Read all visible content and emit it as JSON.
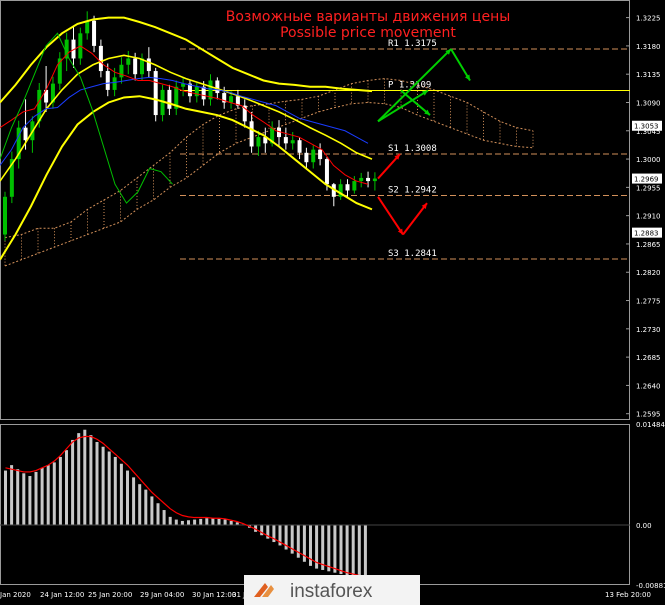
{
  "title": {
    "ru": "Возможные варианты движения цены",
    "en": "Possible price movement"
  },
  "colors": {
    "background": "#000000",
    "frame": "#9a9a9a",
    "grid": "#2a2a2a",
    "bull_candle": "#00c000",
    "bear_candle": "#ffffff",
    "bollinger": "#ffff00",
    "tenkan": "#ff0000",
    "kijun": "#1a3cff",
    "chikou": "#00c000",
    "cloud": "#d2905a",
    "level_line": "#d2905a",
    "pivot_line": "#ffff00",
    "arrow_up": "#00d000",
    "arrow_down": "#ff0000",
    "histogram": "#c8c8c8",
    "signal": "#ff0000",
    "title": "#ff2020",
    "axis_text": "#ffffff"
  },
  "levels": [
    {
      "label": "R1",
      "value_text": "1.3175",
      "value": 1.3175
    },
    {
      "label": "P",
      "value_text": "1.3109",
      "value": 1.3109
    },
    {
      "label": "S1",
      "value_text": "1.3008",
      "value": 1.3008
    },
    {
      "label": "S2",
      "value_text": "1.2942",
      "value": 1.2942
    },
    {
      "label": "S3",
      "value_text": "1.2841",
      "value": 1.2841
    }
  ],
  "price_badges": [
    {
      "text": "1.3053",
      "value": 1.3053
    },
    {
      "text": "1.2969",
      "value": 1.2969
    },
    {
      "text": "1.2883",
      "value": 1.2883
    }
  ],
  "chart_data": {
    "type": "candlestick",
    "panes": [
      {
        "name": "price",
        "y_ticks": [
          "1.3225",
          "1.3180",
          "1.3135",
          "1.3090",
          "1.3045",
          "1.3000",
          "1.2955",
          "1.2910",
          "1.2865",
          "1.2820",
          "1.2775",
          "1.2730",
          "1.2685",
          "1.2640",
          "1.2595"
        ],
        "ylim": [
          1.2585,
          1.3253
        ],
        "candles": [
          [
            1.288,
            1.2948,
            1.287,
            1.294
          ],
          [
            1.294,
            1.3012,
            1.293,
            1.3
          ],
          [
            1.3,
            1.3061,
            1.2985,
            1.305
          ],
          [
            1.305,
            1.3095,
            1.3015,
            1.303
          ],
          [
            1.303,
            1.3068,
            1.301,
            1.306
          ],
          [
            1.306,
            1.3121,
            1.305,
            1.311
          ],
          [
            1.311,
            1.3148,
            1.3075,
            1.309
          ],
          [
            1.309,
            1.3131,
            1.308,
            1.312
          ],
          [
            1.312,
            1.317,
            1.311,
            1.316
          ],
          [
            1.316,
            1.3201,
            1.314,
            1.319
          ],
          [
            1.319,
            1.321,
            1.3145,
            1.316
          ],
          [
            1.316,
            1.3209,
            1.315,
            1.32
          ],
          [
            1.32,
            1.3235,
            1.319,
            1.322
          ],
          [
            1.322,
            1.3228,
            1.317,
            1.318
          ],
          [
            1.318,
            1.319,
            1.313,
            1.314
          ],
          [
            1.314,
            1.3152,
            1.31,
            1.311
          ],
          [
            1.311,
            1.3145,
            1.31,
            1.313
          ],
          [
            1.313,
            1.3162,
            1.312,
            1.315
          ],
          [
            1.315,
            1.3172,
            1.3135,
            1.316
          ],
          [
            1.316,
            1.3169,
            1.3125,
            1.3135
          ],
          [
            1.3135,
            1.3168,
            1.3125,
            1.316
          ],
          [
            1.316,
            1.3178,
            1.313,
            1.314
          ],
          [
            1.314,
            1.3145,
            1.306,
            1.307
          ],
          [
            1.307,
            1.3118,
            1.306,
            1.311
          ],
          [
            1.311,
            1.3118,
            1.307,
            1.308
          ],
          [
            1.308,
            1.3125,
            1.307,
            1.3115
          ],
          [
            1.3115,
            1.313,
            1.31,
            1.312
          ],
          [
            1.312,
            1.3126,
            1.309,
            1.31
          ],
          [
            1.31,
            1.3121,
            1.309,
            1.3115
          ],
          [
            1.3115,
            1.3124,
            1.3085,
            1.3095
          ],
          [
            1.3095,
            1.3135,
            1.3085,
            1.3125
          ],
          [
            1.3125,
            1.313,
            1.3095,
            1.3105
          ],
          [
            1.3105,
            1.3115,
            1.308,
            1.309
          ],
          [
            1.309,
            1.3108,
            1.308,
            1.31
          ],
          [
            1.31,
            1.311,
            1.308,
            1.3085
          ],
          [
            1.3085,
            1.3095,
            1.305,
            1.306
          ],
          [
            1.306,
            1.3075,
            1.301,
            1.302
          ],
          [
            1.302,
            1.3045,
            1.3005,
            1.3035
          ],
          [
            1.3035,
            1.305,
            1.301,
            1.3025
          ],
          [
            1.3025,
            1.306,
            1.302,
            1.305
          ],
          [
            1.305,
            1.3062,
            1.302,
            1.3035
          ],
          [
            1.3035,
            1.305,
            1.3015,
            1.3025
          ],
          [
            1.3025,
            1.3043,
            1.3015,
            1.303
          ],
          [
            1.303,
            1.3035,
            1.3,
            1.301
          ],
          [
            1.301,
            1.3018,
            1.2985,
            1.2995
          ],
          [
            1.2995,
            1.3022,
            1.2985,
            1.3015
          ],
          [
            1.3015,
            1.3025,
            1.299,
            1.3
          ],
          [
            1.3,
            1.3003,
            1.295,
            1.296
          ],
          [
            1.296,
            1.2962,
            1.2925,
            1.294
          ],
          [
            1.294,
            1.2968,
            1.2935,
            1.296
          ],
          [
            1.296,
            1.2968,
            1.294,
            1.295
          ],
          [
            1.295,
            1.2973,
            1.2945,
            1.2965
          ],
          [
            1.2965,
            1.2978,
            1.2955,
            1.297
          ],
          [
            1.297,
            1.298,
            1.2955,
            1.2965
          ],
          [
            1.2965,
            1.2979,
            1.295,
            1.2969
          ]
        ],
        "bollinger_upper": [
          1.309,
          1.3118,
          1.315,
          1.3178,
          1.32,
          1.3215,
          1.3222,
          1.3225,
          1.3225,
          1.3218,
          1.321,
          1.32,
          1.319,
          1.3175,
          1.316,
          1.3145,
          1.3135,
          1.3125,
          1.312,
          1.3118,
          1.3115,
          1.3115,
          1.3112,
          1.311,
          1.3108
        ],
        "bollinger_mid": [
          1.2965,
          1.3,
          1.304,
          1.308,
          1.311,
          1.3135,
          1.315,
          1.316,
          1.3165,
          1.316,
          1.315,
          1.3138,
          1.3128,
          1.312,
          1.3112,
          1.3104,
          1.3095,
          1.3085,
          1.3075,
          1.3063,
          1.305,
          1.3038,
          1.3025,
          1.301,
          1.3
        ],
        "bollinger_lower": [
          1.284,
          1.288,
          1.2925,
          1.2975,
          1.302,
          1.3055,
          1.3075,
          1.309,
          1.3098,
          1.31,
          1.3095,
          1.3088,
          1.308,
          1.3075,
          1.307,
          1.3062,
          1.305,
          1.3038,
          1.302,
          1.3,
          1.298,
          1.296,
          1.2945,
          1.293,
          1.292
        ],
        "tenkan": [
          1.305,
          1.3062,
          1.3075,
          1.308,
          1.311,
          1.315,
          1.317,
          1.318,
          1.3168,
          1.315,
          1.3138,
          1.3132,
          1.3125,
          1.3125,
          1.312,
          1.3115,
          1.3108,
          1.3104,
          1.31,
          1.3096,
          1.309,
          1.3085,
          1.307,
          1.3058,
          1.3045,
          1.304,
          1.3035,
          1.3025,
          1.3015,
          1.299,
          1.2975,
          1.2965,
          1.296
        ],
        "kijun": [
          1.299,
          1.3015,
          1.305,
          1.3068,
          1.308,
          1.3082,
          1.3098,
          1.311,
          1.3115,
          1.312,
          1.3122,
          1.3125,
          1.3128,
          1.313,
          1.3128,
          1.3125,
          1.312,
          1.3116,
          1.3112,
          1.311,
          1.3106,
          1.31,
          1.3095,
          1.309,
          1.3085,
          1.3075,
          1.3065,
          1.306,
          1.3055,
          1.305,
          1.3045,
          1.3035,
          1.3025
        ],
        "chikou": [
          1.3,
          1.305,
          1.309,
          1.3135,
          1.318,
          1.32,
          1.316,
          1.313,
          1.308,
          1.302,
          1.296,
          1.293,
          1.2948,
          1.2985,
          1.298,
          1.296
        ],
        "cloud_span_a": [
          1.2875,
          1.288,
          1.289,
          1.289,
          1.29,
          1.292,
          1.2935,
          1.295,
          1.297,
          1.299,
          1.301,
          1.3035,
          1.3055,
          1.307,
          1.308,
          1.3085,
          1.3088,
          1.3092,
          1.3095,
          1.31,
          1.311,
          1.312,
          1.3125,
          1.3128,
          1.3125,
          1.3118,
          1.311,
          1.31,
          1.309,
          1.3075,
          1.306,
          1.305,
          1.3045
        ],
        "cloud_span_b": [
          1.283,
          1.284,
          1.285,
          1.286,
          1.287,
          1.288,
          1.289,
          1.29,
          1.292,
          1.2935,
          1.2955,
          1.297,
          1.299,
          1.301,
          1.3025,
          1.3035,
          1.3045,
          1.3055,
          1.3065,
          1.3075,
          1.3082,
          1.3088,
          1.309,
          1.3088,
          1.3082,
          1.307,
          1.306,
          1.305,
          1.304,
          1.303,
          1.3025,
          1.302,
          1.3018
        ],
        "forecast": [
          {
            "from": 1.306,
            "to": 1.3175,
            "color": "arrow_up"
          },
          {
            "from": 1.3175,
            "to": 1.3125,
            "color": "arrow_up"
          },
          {
            "from": 1.306,
            "to": 1.3109,
            "color": "arrow_up"
          },
          {
            "from": 1.3109,
            "to": 1.307,
            "color": "arrow_up"
          },
          {
            "from": 1.2969,
            "to": 1.3008,
            "color": "arrow_down"
          },
          {
            "from": 1.294,
            "to": 1.288,
            "color": "arrow_down"
          },
          {
            "from": 1.288,
            "to": 1.293,
            "color": "arrow_down"
          }
        ]
      },
      {
        "name": "oscillator",
        "y_ticks": [
          "0.01484",
          "0.00",
          "-0.00881"
        ],
        "ylim": [
          -0.00881,
          0.01484
        ],
        "histogram": [
          0.008,
          0.0088,
          0.0082,
          0.0076,
          0.0072,
          0.0078,
          0.0084,
          0.0088,
          0.0092,
          0.01,
          0.011,
          0.0125,
          0.0135,
          0.014,
          0.0132,
          0.0122,
          0.0115,
          0.0108,
          0.01,
          0.009,
          0.008,
          0.007,
          0.006,
          0.0052,
          0.0042,
          0.0032,
          0.0022,
          0.0012,
          0.0008,
          0.0006,
          0.0007,
          0.0008,
          0.0009,
          0.001,
          0.001,
          0.0009,
          0.0008,
          0.0006,
          0.0004,
          0.0001,
          -0.0004,
          -0.001,
          -0.0015,
          -0.002,
          -0.0025,
          -0.003,
          -0.0036,
          -0.0042,
          -0.0048,
          -0.0054,
          -0.006,
          -0.0064,
          -0.0066,
          -0.0068,
          -0.007,
          -0.0072,
          -0.0074,
          -0.0076,
          -0.0078,
          -0.008
        ],
        "signal": [
          0.0084,
          0.0082,
          0.008,
          0.0078,
          0.0078,
          0.008,
          0.0084,
          0.0088,
          0.0094,
          0.0102,
          0.0112,
          0.0122,
          0.0128,
          0.013,
          0.013,
          0.0126,
          0.012,
          0.0112,
          0.0104,
          0.0096,
          0.0088,
          0.0078,
          0.0068,
          0.0058,
          0.0048,
          0.004,
          0.0032,
          0.0024,
          0.0018,
          0.0014,
          0.0012,
          0.0011,
          0.0011,
          0.0011,
          0.001,
          0.001,
          0.0009,
          0.0007,
          0.0005,
          0.0002,
          -0.0002,
          -0.0006,
          -0.0011,
          -0.0016,
          -0.002,
          -0.0025,
          -0.003,
          -0.0035,
          -0.004,
          -0.0045,
          -0.005,
          -0.0055,
          -0.0058,
          -0.0061,
          -0.0064,
          -0.0067,
          -0.007,
          -0.0072,
          -0.0074,
          -0.0076
        ]
      }
    ],
    "x_ticks": [
      "Jan 2020",
      "24 Jan 12:00",
      "25 Jan 20:00",
      "29 Jan 04:00",
      "30 Jan 12:00",
      "31 Jan",
      "Feb 12:00",
      "13 Feb 20:00"
    ]
  },
  "watermark": {
    "brand": "instaforex"
  }
}
